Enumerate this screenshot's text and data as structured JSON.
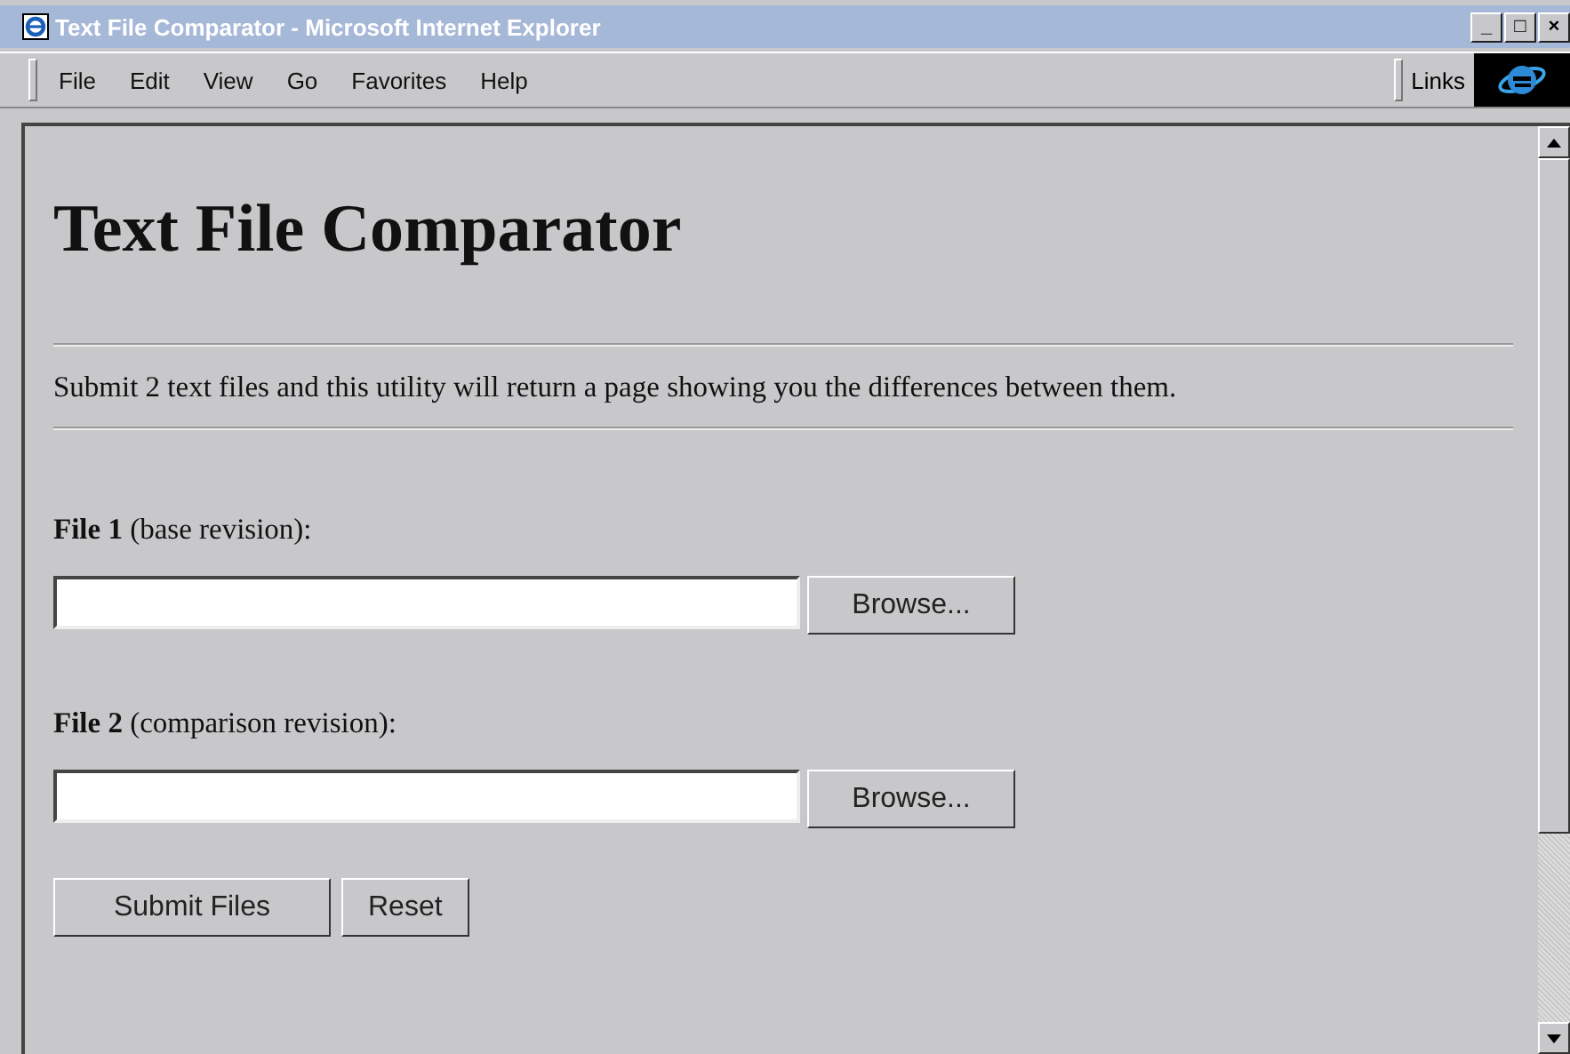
{
  "window": {
    "title": "Text File Comparator - Microsoft Internet Explorer",
    "controls": [
      "_",
      "□",
      "×"
    ]
  },
  "menu": [
    "File",
    "Edit",
    "View",
    "Go",
    "Favorites",
    "Help"
  ],
  "links_label": "Links",
  "page": {
    "heading": "Text File Comparator",
    "intro": "Submit 2 text files and this utility will return a page showing you the differences between them.",
    "files": [
      {
        "label": "**File 1** (base revision):",
        "browse": "Browse..."
      },
      {
        "label": "**File 2** (comparison revision):",
        "browse": "Browse..."
      }
    ],
    "buttons": [
      "Submit Files",
      "Reset"
    ]
  }
}
